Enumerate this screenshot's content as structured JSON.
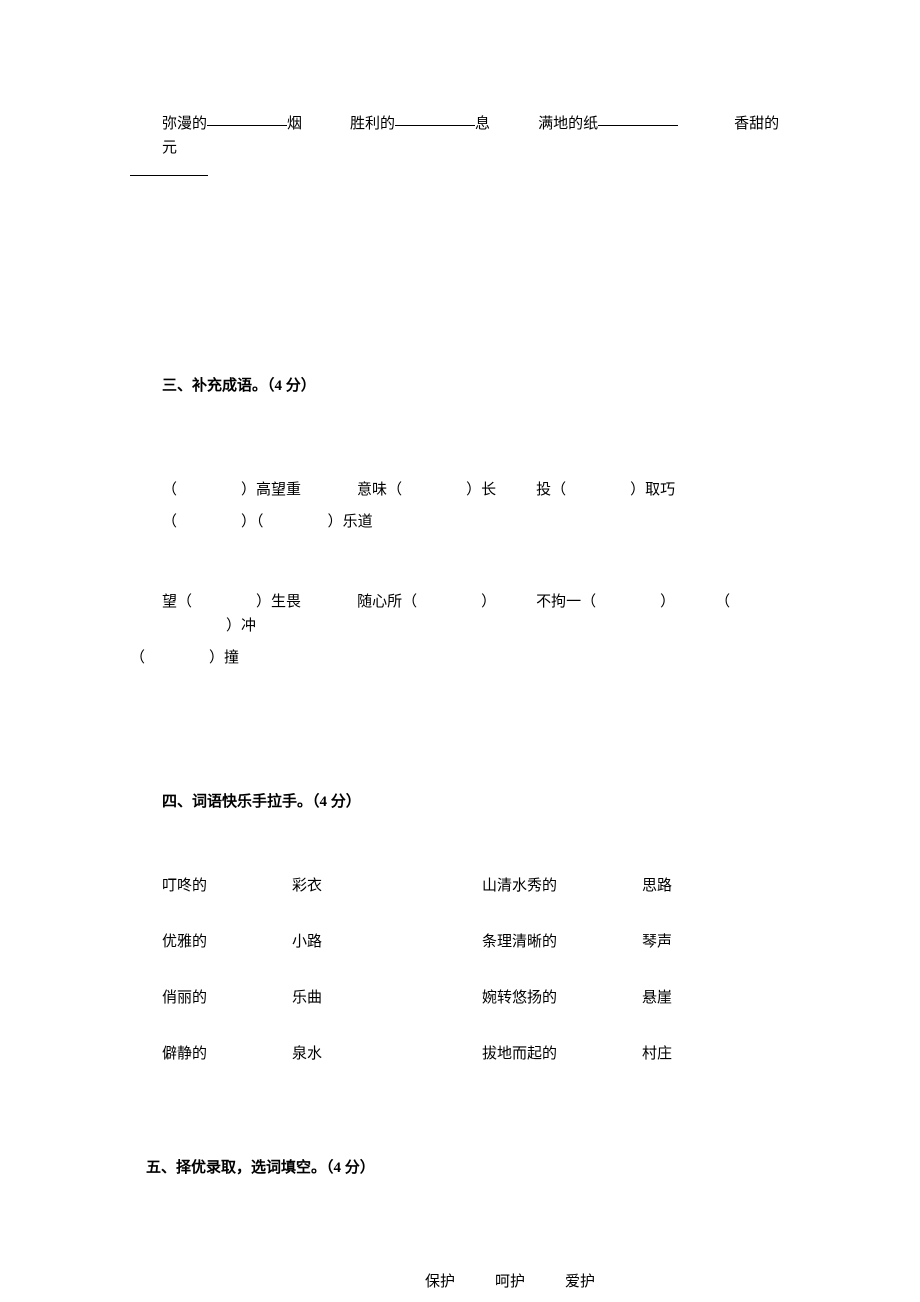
{
  "topLine": {
    "prefix1": "弥漫的",
    "suffix1": "烟",
    "prefix2": "胜利的",
    "suffix2": "息",
    "prefix3": "满地的纸",
    "prefix4": "香甜的元"
  },
  "section3": {
    "title": "三、补充成语。（4 分）",
    "idioms": {
      "i1_suffix": "高望重",
      "i2_prefix": "意味",
      "i2_suffix": "长",
      "i3_prefix": "投",
      "i3_suffix": "取巧",
      "i4_suffix": "乐道",
      "i5_prefix": "望",
      "i5_suffix": "生畏",
      "i6_prefix": "随心所",
      "i7_prefix": "不拘一",
      "i8_mid": "冲",
      "i8_suffix": "撞"
    }
  },
  "section4": {
    "title": "四、词语快乐手拉手。（4 分）",
    "rows": [
      {
        "l1": "叮咚的",
        "l2": "彩衣",
        "r1": "山清水秀的",
        "r2": "思路"
      },
      {
        "l1": "优雅的",
        "l2": "小路",
        "r1": "条理清晰的",
        "r2": "琴声"
      },
      {
        "l1": "俏丽的",
        "l2": "乐曲",
        "r1": "婉转悠扬的",
        "r2": "悬崖"
      },
      {
        "l1": "僻静的",
        "l2": "泉水",
        "r1": "拔地而起的",
        "r2": "村庄"
      }
    ]
  },
  "section5": {
    "title": "五、择优录取，选词填空。（4 分）",
    "options": [
      "保护",
      "呵护",
      "爱护"
    ]
  }
}
